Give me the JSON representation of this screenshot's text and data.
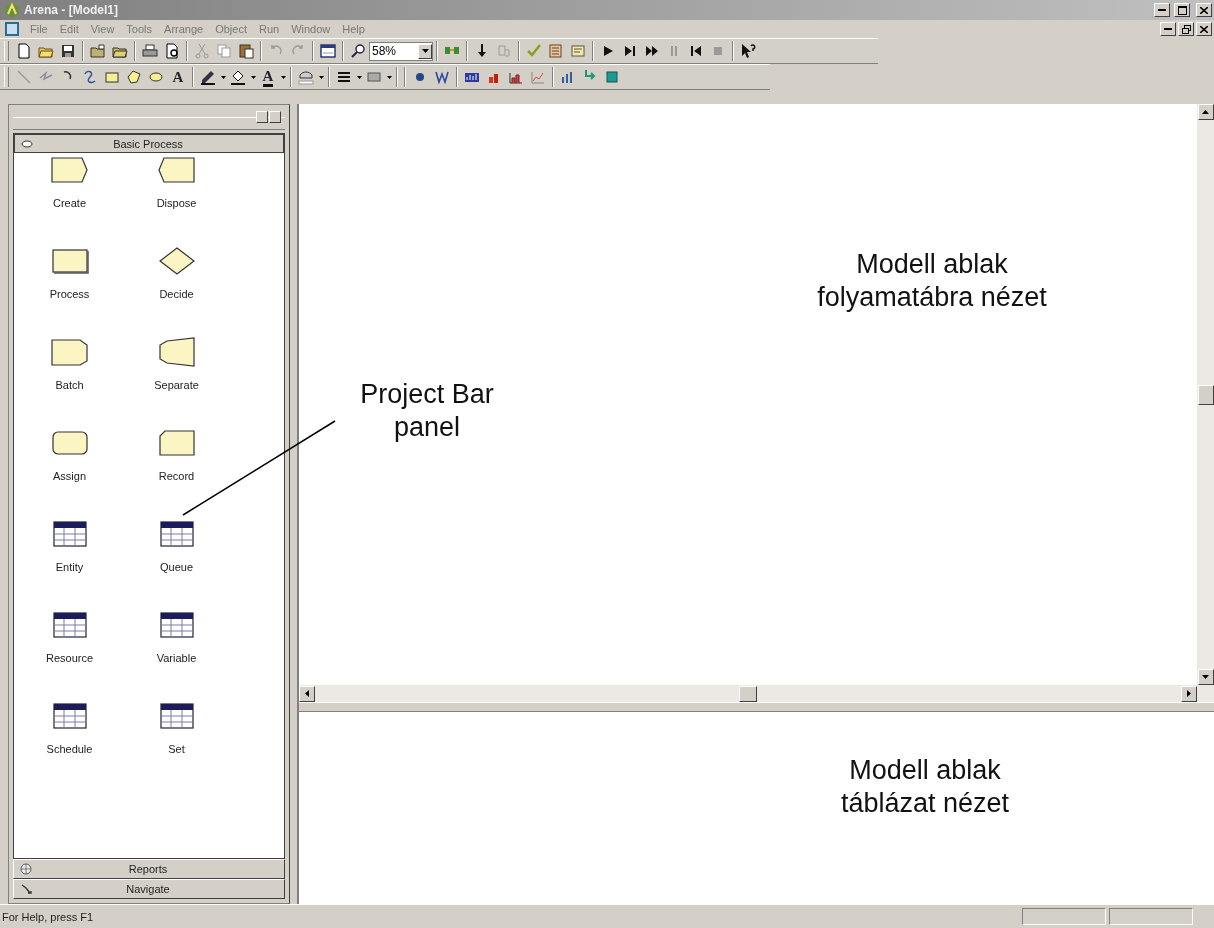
{
  "window": {
    "title": "Arena - [Model1]"
  },
  "menu": [
    "File",
    "Edit",
    "View",
    "Tools",
    "Arrange",
    "Object",
    "Run",
    "Window",
    "Help"
  ],
  "standard_toolbar": {
    "zoom_value": "58%"
  },
  "drawing_toolbar": {
    "text_tool": "A",
    "font_color": "A"
  },
  "project_bar": {
    "panels": [
      {
        "label": "Basic Process",
        "expanded": true,
        "modules": [
          {
            "label": "Create",
            "kind": "create"
          },
          {
            "label": "Dispose",
            "kind": "dispose"
          },
          {
            "label": "Process",
            "kind": "process"
          },
          {
            "label": "Decide",
            "kind": "decide"
          },
          {
            "label": "Batch",
            "kind": "batch"
          },
          {
            "label": "Separate",
            "kind": "separate"
          },
          {
            "label": "Assign",
            "kind": "assign"
          },
          {
            "label": "Record",
            "kind": "record"
          },
          {
            "label": "Entity",
            "kind": "data"
          },
          {
            "label": "Queue",
            "kind": "data"
          },
          {
            "label": "Resource",
            "kind": "data"
          },
          {
            "label": "Variable",
            "kind": "data"
          },
          {
            "label": "Schedule",
            "kind": "data"
          },
          {
            "label": "Set",
            "kind": "data"
          }
        ]
      },
      {
        "label": "Reports",
        "expanded": false
      },
      {
        "label": "Navigate",
        "expanded": false
      }
    ]
  },
  "annotations": [
    {
      "lines": [
        "Project Bar",
        "panel"
      ],
      "kind": "project_bar"
    },
    {
      "lines": [
        "Modell ablak",
        "folyamatábra nézet"
      ],
      "kind": "flowchart"
    },
    {
      "lines": [
        "Modell ablak",
        "táblázat nézet"
      ],
      "kind": "table"
    }
  ],
  "status_bar": {
    "text": "For Help, press F1"
  }
}
